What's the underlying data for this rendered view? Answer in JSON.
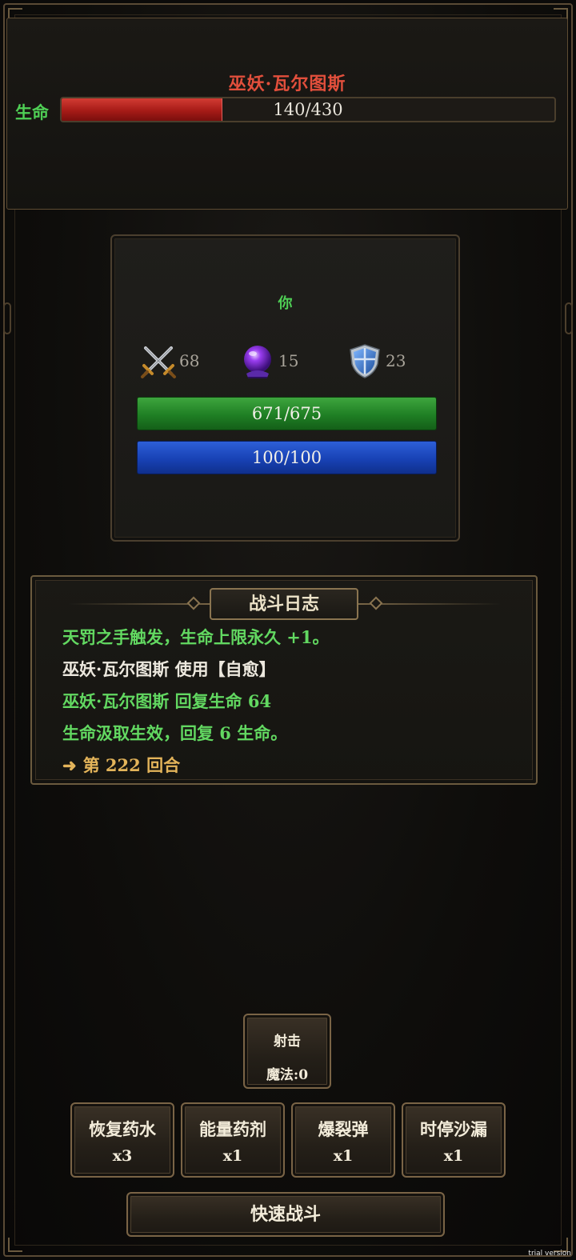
{
  "enemy": {
    "name": "巫妖·瓦尔图斯",
    "hp_label": "生命",
    "hp_text": "140/430",
    "hp_fraction": 0.3256
  },
  "player": {
    "name": "你",
    "stats": {
      "attack": "68",
      "magic": "15",
      "defense": "23"
    },
    "hp_text": "671/675",
    "mp_text": "100/100"
  },
  "log": {
    "title": "战斗日志",
    "lines": [
      {
        "text": "天罚之手触发，生命上限永久 +1。",
        "color": "green"
      },
      {
        "text": "巫妖·瓦尔图斯 使用【自愈】",
        "color": "white"
      },
      {
        "text": "巫妖·瓦尔图斯 回复生命 64",
        "color": "green"
      },
      {
        "text": "生命汲取生效，回复 6 生命。",
        "color": "green"
      },
      {
        "text": "第 222 回合",
        "color": "gold",
        "arrow": "➜"
      }
    ]
  },
  "actions": {
    "shoot": {
      "label": "射击",
      "cost": "魔法:0"
    },
    "items": [
      {
        "name": "恢复药水",
        "count": "x3"
      },
      {
        "name": "能量药剂",
        "count": "x1"
      },
      {
        "name": "爆裂弹",
        "count": "x1"
      },
      {
        "name": "时停沙漏",
        "count": "x1"
      }
    ],
    "quick_battle": "快速战斗"
  },
  "watermark": "trial version",
  "colors": {
    "enemy_name": "#e24f3c",
    "hp_green": "#4fcf55",
    "enemy_hp": "#a61b17",
    "player_hp": "#1f7f24",
    "player_mp": "#1842b5",
    "gold": "#e3b45a"
  },
  "icons": {
    "attack": "crossed-swords-icon",
    "magic": "crystal-ball-icon",
    "defense": "shield-icon"
  }
}
